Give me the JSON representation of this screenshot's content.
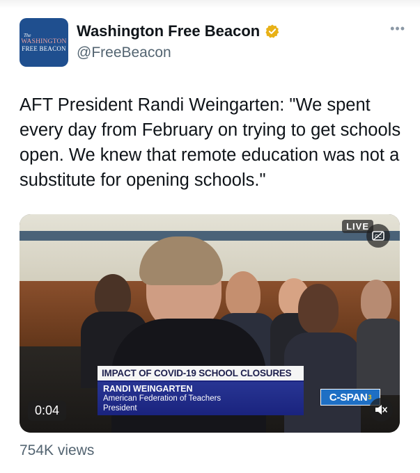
{
  "account": {
    "avatar_text": {
      "the": "The",
      "line1": "WASHINGTON",
      "line2": "FREE BEACON"
    },
    "display_name": "Washington Free Beacon",
    "handle": "@FreeBeacon",
    "verified_color": "#e8b117",
    "more_label": "•••"
  },
  "tweet": {
    "text": "AFT President Randi Weingarten: \"We spent every day from February on trying to get schools open. We knew that remote education was not a substitute for opening schools.\""
  },
  "video": {
    "live_label": "LIVE",
    "lower_third": {
      "title": "IMPACT OF COVID-19 SCHOOL CLOSURES",
      "name": "RANDI WEINGARTEN",
      "org": "American Federation of Teachers",
      "role": "President"
    },
    "network": "C-SPAN",
    "network_number": "3",
    "timestamp": "0:04",
    "icons": [
      "captions-icon",
      "mute-icon"
    ]
  },
  "stats": {
    "views": "754K views"
  },
  "colors": {
    "text": "#0f1419",
    "secondary": "#536471",
    "avatar_bg": "#1f4f8f",
    "cspan_blue": "#1e6fc4"
  }
}
